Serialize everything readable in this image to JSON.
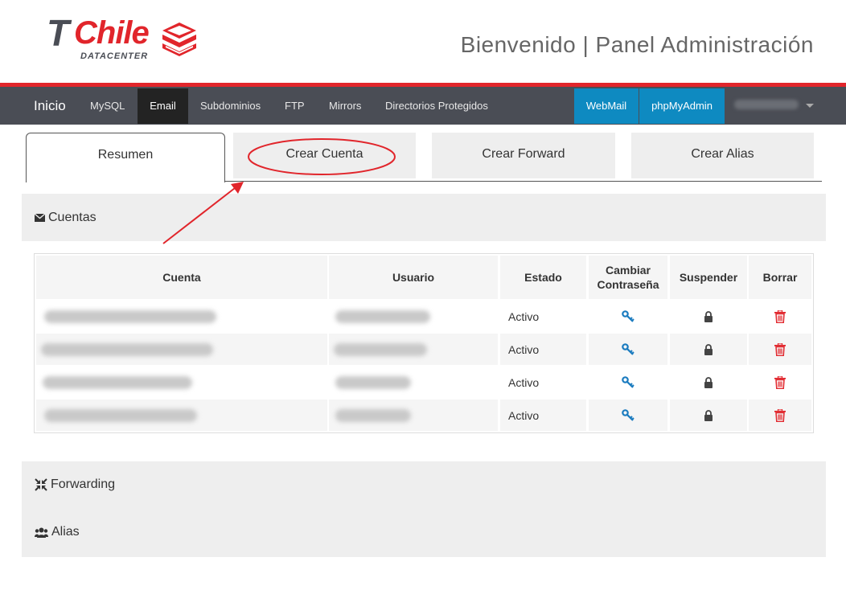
{
  "header": {
    "logo_t": "T",
    "logo_chile": "Chile",
    "logo_sub": "DATACENTER",
    "title": "Bienvenido | Panel Administración"
  },
  "nav": {
    "brand": "Inicio",
    "items": [
      "MySQL",
      "Email",
      "Subdominios",
      "FTP",
      "Mirrors",
      "Directorios Protegidos"
    ],
    "active": "Email",
    "right": [
      "WebMail",
      "phpMyAdmin"
    ]
  },
  "tabs": [
    "Resumen",
    "Crear Cuenta",
    "Crear Forward",
    "Crear Alias"
  ],
  "sections": {
    "cuentas": "Cuentas",
    "forwarding": "Forwarding",
    "alias": "Alias"
  },
  "table": {
    "headers": [
      "Cuenta",
      "Usuario",
      "Estado",
      "Cambiar Contraseña",
      "Suspender",
      "Borrar"
    ],
    "rows": [
      {
        "estado": "Activo"
      },
      {
        "estado": "Activo"
      },
      {
        "estado": "Activo"
      },
      {
        "estado": "Activo"
      }
    ]
  },
  "icons": {
    "password": "key-icon",
    "suspend": "lock-icon",
    "delete": "trash-icon"
  },
  "colors": {
    "brand_red": "#e1252b",
    "navbar": "#4a4d55",
    "nav_blue": "#0e8ac1",
    "key": "#1a7bbf",
    "trash": "#e1252b"
  }
}
